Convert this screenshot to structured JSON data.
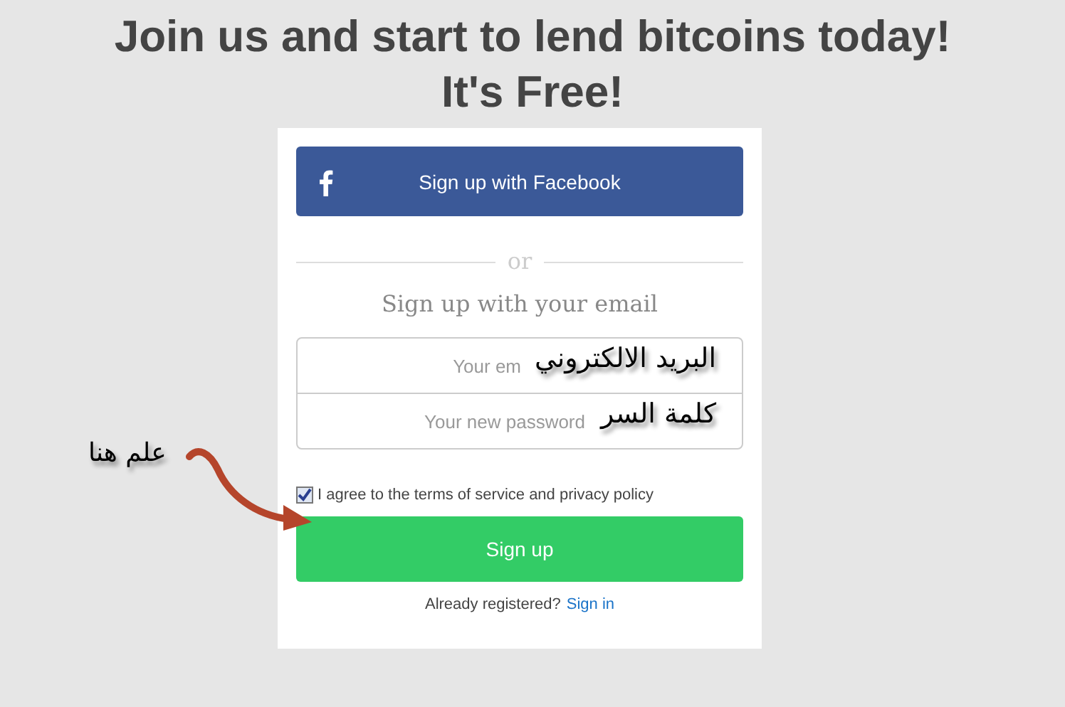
{
  "heading": {
    "lines": [
      "Join us and start to lend bitcoins today!",
      "It's Free!"
    ]
  },
  "signup_card": {
    "facebook_button": {
      "label": "Sign up with Facebook"
    },
    "divider": "or",
    "subtitle": "Sign up with your email",
    "fields": [
      {
        "placeholder": "Your em",
        "annotation": "البريد الالكتروني"
      },
      {
        "placeholder": "Your new password",
        "annotation": "كلمة السر"
      }
    ],
    "terms": {
      "label": "I agree to the terms of service and privacy policy",
      "checked": true
    },
    "submit_button": {
      "label": "Sign up"
    },
    "signin": {
      "prompt": "Already registered?",
      "link": "Sign in"
    }
  },
  "callout": {
    "text": "علم هنا"
  }
}
